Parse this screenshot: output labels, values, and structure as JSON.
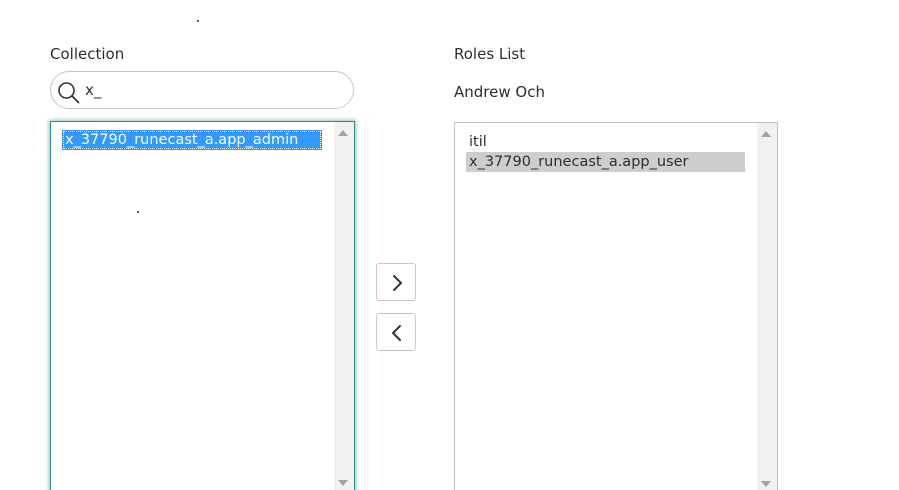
{
  "collection": {
    "heading": "Collection",
    "search_value": "x_",
    "search_icon": "search-icon",
    "items": [
      {
        "label": "x_37790_runecast_a.app_admin",
        "selected": true
      }
    ]
  },
  "move_buttons": {
    "add_icon": "chevron-right-icon",
    "remove_icon": "chevron-left-icon"
  },
  "roles": {
    "heading": "Roles List",
    "user_name": "Andrew Och",
    "items": [
      {
        "label": "itil",
        "selected": false
      },
      {
        "label": "x_37790_runecast_a.app_user",
        "selected": true
      }
    ]
  },
  "colors": {
    "focus_border": "#2e8f86",
    "active_selection": "#3399ff",
    "inactive_selection": "#cdcdcd"
  }
}
